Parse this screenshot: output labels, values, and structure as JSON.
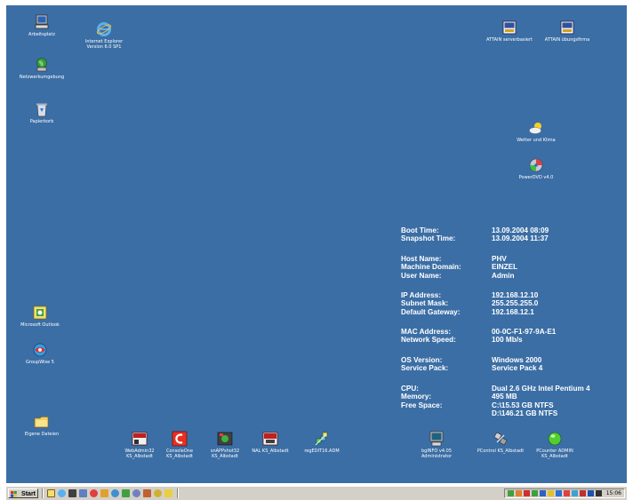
{
  "desktop_icons": {
    "arbeitsplatz": "Arbeitsplatz",
    "internet_explorer": [
      "Internet Explorer",
      "Version 6.0 SP1"
    ],
    "netzwerkumgebung": "Netzwerkumgebung",
    "papierkorb": "Papierkorb",
    "attain_serverbasiert": "ATTAIN serverbasiert",
    "attain_uebungsfirma": "ATTAIN übungsfirma",
    "wetter_und_klima": "Wetter und Klima",
    "powerdvd": "PowerDVD v4.0",
    "microsoft_outlook": "Microsoft Outlook",
    "groupwise": "GroupWise 5",
    "eigene_dateien": "Eigene Dateien",
    "webadmin": [
      "WebAdmin32",
      "KS_Albstadt"
    ],
    "consoleone": [
      "ConsoleOne",
      "KS_Albstadt"
    ],
    "snapshot": [
      "snAPPshot32",
      "KS_Albstadt"
    ],
    "nal": "NAL KS_Albstadt",
    "regedit": "regEDIT16.ADM",
    "bginfo_admin": [
      "bgINFO v4.05",
      "Administrator"
    ],
    "pcontrol": "PControl KS_Albstadt",
    "pcounter": [
      "PCounter ADMIN",
      "KS_Albstadt"
    ]
  },
  "bginfo": {
    "boot_time": {
      "key": "Boot Time:",
      "value": "13.09.2004 08:09"
    },
    "snapshot_time": {
      "key": "Snapshot Time:",
      "value": "13.09.2004 11:37"
    },
    "host_name": {
      "key": "Host Name:",
      "value": "PHV"
    },
    "machine_domain": {
      "key": "Machine Domain:",
      "value": "EINZEL"
    },
    "user_name": {
      "key": "User Name:",
      "value": "Admin"
    },
    "ip_address": {
      "key": "IP Address:",
      "value": "192.168.12.10"
    },
    "subnet_mask": {
      "key": "Subnet Mask:",
      "value": "255.255.255.0"
    },
    "default_gateway": {
      "key": "Default Gateway:",
      "value": "192.168.12.1"
    },
    "mac_address": {
      "key": "MAC Address:",
      "value": "00-0C-F1-97-9A-E1"
    },
    "network_speed": {
      "key": "Network Speed:",
      "value": "100 Mb/s"
    },
    "os_version": {
      "key": "OS Version:",
      "value": "Windows 2000"
    },
    "service_pack": {
      "key": "Service Pack:",
      "value": "Service Pack 4"
    },
    "cpu": {
      "key": "CPU:",
      "value": "Dual 2.6 GHz Intel Pentium 4"
    },
    "memory": {
      "key": "Memory:",
      "value": "495 MB"
    },
    "free_space": {
      "key": "Free Space:",
      "values": [
        "C:\\15.53 GB NTFS",
        "D:\\146.21 GB NTFS"
      ]
    }
  },
  "taskbar": {
    "start_label": "Start",
    "clock": "15:06"
  },
  "colors": {
    "desktop": "#3b6ea5",
    "taskbar": "#d4d0c8"
  }
}
